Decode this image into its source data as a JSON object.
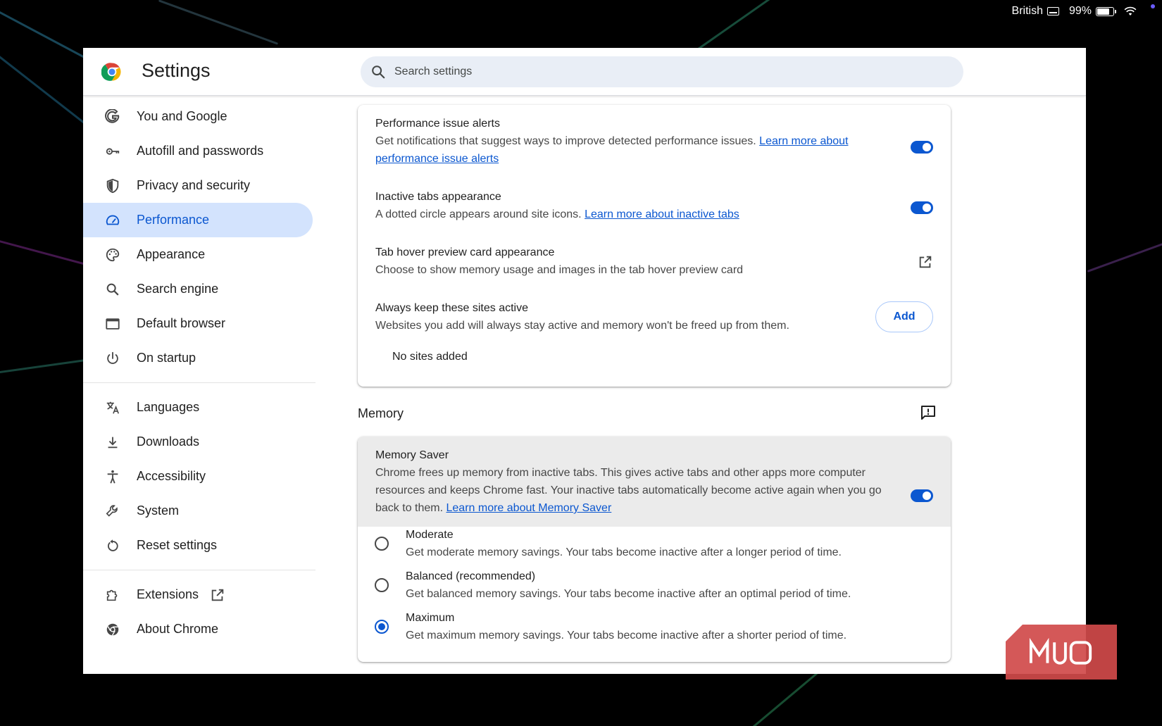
{
  "menubar": {
    "keyboard_layout": "British",
    "battery_percent": "99%"
  },
  "window": {
    "title": "Settings",
    "search": {
      "placeholder": "Search settings"
    }
  },
  "sidebar": {
    "items": [
      {
        "label": "You and Google",
        "icon": "google-icon"
      },
      {
        "label": "Autofill and passwords",
        "icon": "key-icon"
      },
      {
        "label": "Privacy and security",
        "icon": "shield-icon"
      },
      {
        "label": "Performance",
        "icon": "speedometer-icon",
        "active": true
      },
      {
        "label": "Appearance",
        "icon": "palette-icon"
      },
      {
        "label": "Search engine",
        "icon": "search-icon"
      },
      {
        "label": "Default browser",
        "icon": "browser-window-icon"
      },
      {
        "label": "On startup",
        "icon": "power-icon"
      },
      {
        "label": "Languages",
        "icon": "translate-icon"
      },
      {
        "label": "Downloads",
        "icon": "download-icon"
      },
      {
        "label": "Accessibility",
        "icon": "accessibility-icon"
      },
      {
        "label": "System",
        "icon": "wrench-icon"
      },
      {
        "label": "Reset settings",
        "icon": "reset-icon"
      },
      {
        "label": "Extensions",
        "icon": "puzzle-icon"
      },
      {
        "label": "About Chrome",
        "icon": "chrome-icon"
      }
    ]
  },
  "performance": {
    "alerts": {
      "title": "Performance issue alerts",
      "desc": "Get notifications that suggest ways to improve detected performance issues. ",
      "link": "Learn more about performance issue alerts",
      "enabled": true
    },
    "inactive_tabs": {
      "title": "Inactive tabs appearance",
      "desc": "A dotted circle appears around site icons. ",
      "link": "Learn more about inactive tabs",
      "enabled": true
    },
    "hover_card": {
      "title": "Tab hover preview card appearance",
      "desc": "Choose to show memory usage and images in the tab hover preview card"
    },
    "keep_active": {
      "title": "Always keep these sites active",
      "desc": "Websites you add will always stay active and memory won't be freed up from them.",
      "add_label": "Add",
      "empty_text": "No sites added"
    }
  },
  "memory": {
    "heading": "Memory",
    "saver": {
      "title": "Memory Saver",
      "desc": "Chrome frees up memory from inactive tabs. This gives active tabs and other apps more computer resources and keeps Chrome fast. Your inactive tabs automatically become active again when you go back to them. ",
      "link": "Learn more about Memory Saver",
      "enabled": true
    },
    "options": [
      {
        "title": "Moderate",
        "desc": "Get moderate memory savings. Your tabs become inactive after a longer period of time.",
        "checked": false
      },
      {
        "title": "Balanced (recommended)",
        "desc": "Get balanced memory savings. Your tabs become inactive after an optimal period of time.",
        "checked": false
      },
      {
        "title": "Maximum",
        "desc": "Get maximum memory savings. Your tabs become inactive after a shorter period of time.",
        "checked": true
      }
    ]
  },
  "colors": {
    "accent": "#0b57d0",
    "active_nav_bg": "#d3e3fd",
    "watermark": "#d04a4a"
  }
}
